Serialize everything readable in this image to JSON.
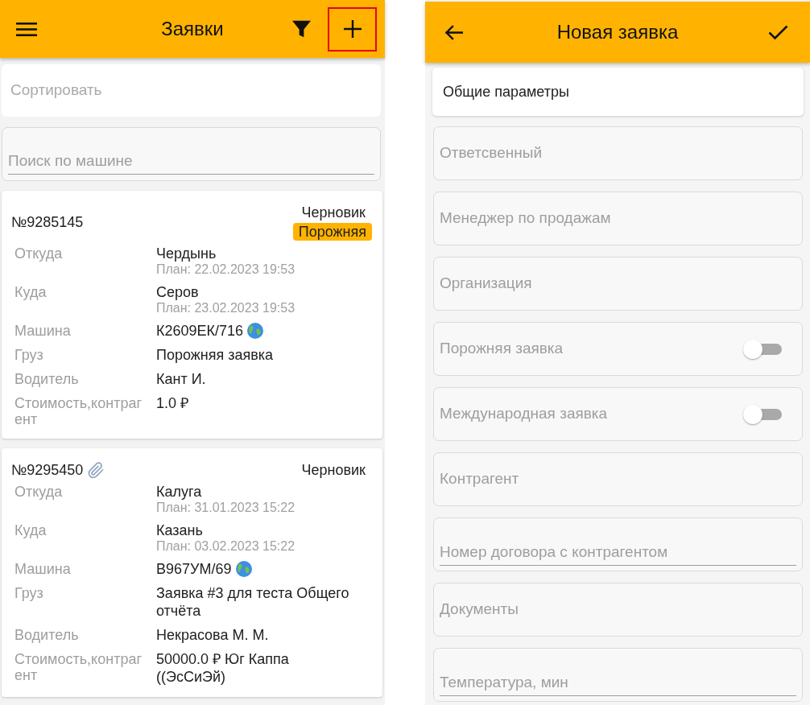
{
  "orders_screen": {
    "toolbar": {
      "title": "Заявки",
      "add_highlighted": true
    },
    "sort": {
      "label": "Сортировать"
    },
    "search": {
      "placeholder": "Поиск по машине"
    },
    "orders": [
      {
        "number": "№9285145",
        "attachment": false,
        "status": "Черновик",
        "tag": "Порожняя",
        "rows": [
          {
            "kind": "place",
            "label": "Откуда",
            "value": "Чердынь",
            "plan": "План: 22.02.2023 19:53"
          },
          {
            "kind": "place",
            "label": "Куда",
            "value": "Серов",
            "plan": "План: 23.02.2023 19:53"
          },
          {
            "kind": "vehicle",
            "label": "Машина",
            "value": "К2609ЕК/716"
          },
          {
            "kind": "text",
            "label": "Груз",
            "value": "Порожняя заявка"
          },
          {
            "kind": "text",
            "label": "Водитель",
            "value": "Кант И."
          },
          {
            "kind": "text",
            "label": "Стоимость,контрагент",
            "value": "1.0 ₽"
          }
        ]
      },
      {
        "number": "№9295450",
        "attachment": true,
        "status": "Черновик",
        "rows": [
          {
            "kind": "place",
            "label": "Откуда",
            "value": "Калуга",
            "plan": "План: 31.01.2023 15:22"
          },
          {
            "kind": "place",
            "label": "Куда",
            "value": "Казань",
            "plan": "План: 03.02.2023 15:22"
          },
          {
            "kind": "vehicle",
            "label": "Машина",
            "value": "В967УМ/69"
          },
          {
            "kind": "text",
            "label": "Груз",
            "value": "Заявка #3 для теста Общего отчёта"
          },
          {
            "kind": "text",
            "label": "Водитель",
            "value": "Некрасова М. М."
          },
          {
            "kind": "text",
            "label": "Стоимость,контрагент",
            "value": "50000.0 ₽ Юг Каппа ((ЭсСиЭй)"
          }
        ]
      }
    ]
  },
  "new_order_screen": {
    "title": "Новая заявка",
    "section": "Общие параметры",
    "fields": [
      {
        "kind": "picker",
        "label": "Ответсвенный"
      },
      {
        "kind": "picker",
        "label": "Менеджер по продажам"
      },
      {
        "kind": "picker",
        "label": "Организация"
      },
      {
        "kind": "toggle",
        "label": "Порожняя заявка",
        "on": false
      },
      {
        "kind": "toggle",
        "label": "Международная заявка",
        "on": false
      },
      {
        "kind": "picker",
        "label": "Контрагент"
      },
      {
        "kind": "input",
        "placeholder": "Номер договора с контрагентом"
      },
      {
        "kind": "picker",
        "label": "Документы"
      },
      {
        "kind": "input",
        "placeholder": "Температура, мин"
      }
    ]
  }
}
